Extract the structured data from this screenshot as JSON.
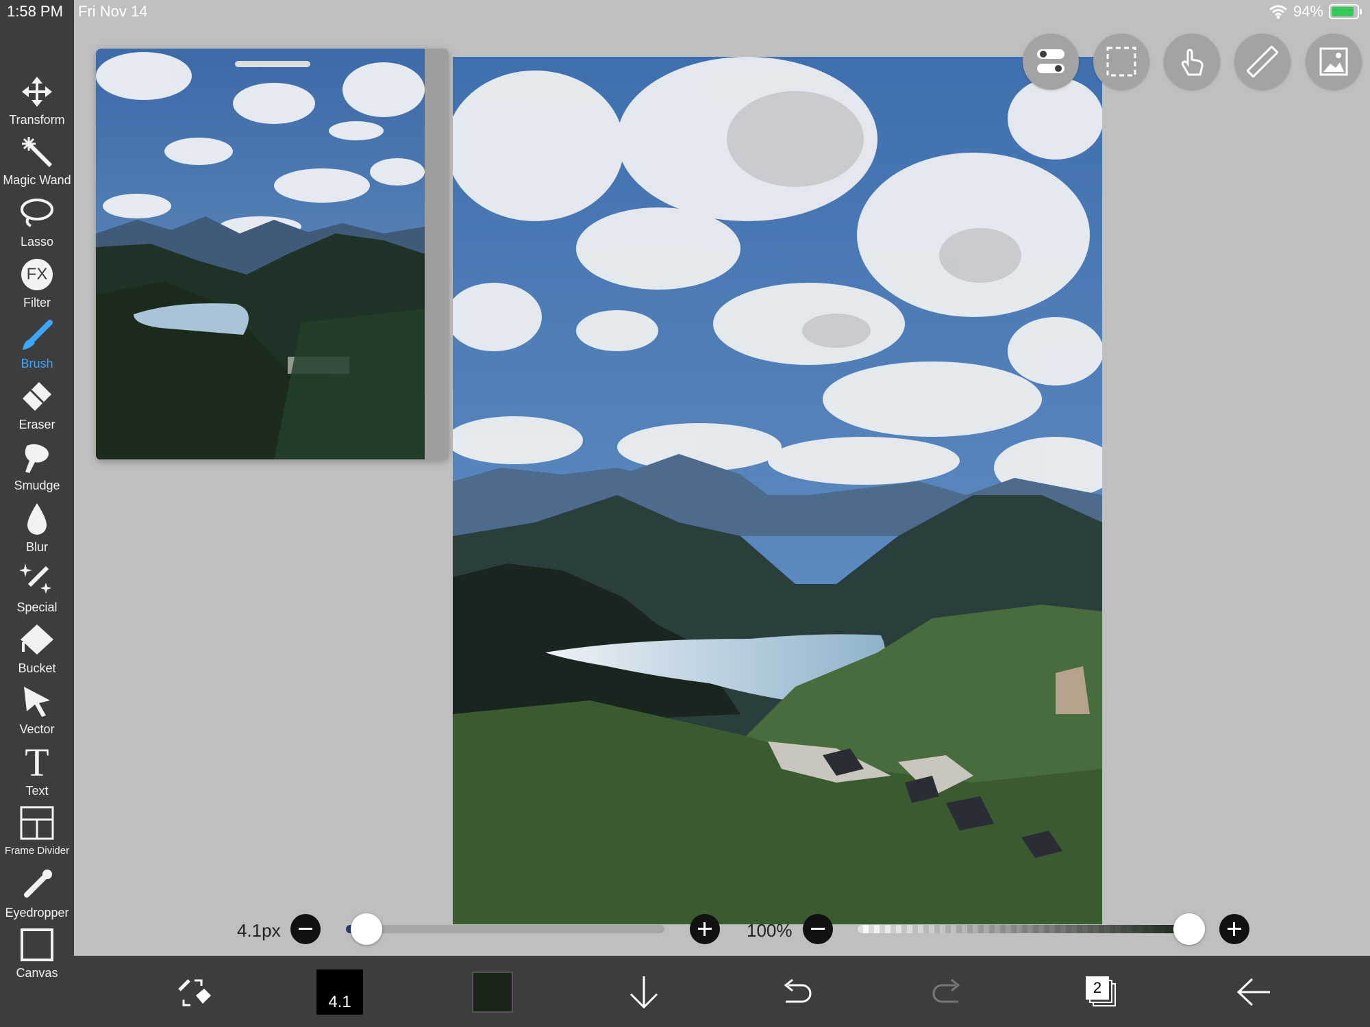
{
  "status": {
    "time": "1:58 PM",
    "date": "Fri Nov 14",
    "battery": "94%"
  },
  "tools": [
    {
      "label": "Transform",
      "icon": "move-arrows-icon"
    },
    {
      "label": "Magic Wand",
      "icon": "magic-wand-icon"
    },
    {
      "label": "Lasso",
      "icon": "lasso-icon"
    },
    {
      "label": "Filter",
      "icon": "fx-icon"
    },
    {
      "label": "Brush",
      "icon": "brush-icon",
      "active": true
    },
    {
      "label": "Eraser",
      "icon": "eraser-icon"
    },
    {
      "label": "Smudge",
      "icon": "smudge-finger-icon"
    },
    {
      "label": "Blur",
      "icon": "droplet-icon"
    },
    {
      "label": "Special",
      "icon": "sparkle-pen-icon"
    },
    {
      "label": "Bucket",
      "icon": "bucket-icon"
    },
    {
      "label": "Vector",
      "icon": "cursor-arrow-icon"
    },
    {
      "label": "Text",
      "icon": "text-t-icon"
    },
    {
      "label": "Frame Divider",
      "icon": "frame-divider-icon"
    },
    {
      "label": "Eyedropper",
      "icon": "eyedropper-icon"
    },
    {
      "label": "Canvas",
      "icon": "canvas-square-icon"
    }
  ],
  "fx_glyph": "FX",
  "text_glyph": "T",
  "topbar_buttons": [
    "toggle-switch-icon",
    "selection-marquee-icon",
    "touch-gesture-icon",
    "ruler-icon",
    "image-reference-icon"
  ],
  "brush_size": {
    "label": "4.1px",
    "value": 4.1
  },
  "opacity": {
    "label": "100%",
    "value": 1.0
  },
  "bottom": {
    "brush_preview_value": "4.1",
    "layer_count": "2",
    "current_color": "#1a2419"
  },
  "colors": {
    "accent": "#3da6ff",
    "toolbar_bg": "#3d3d3d",
    "workspace_bg": "#bfbfbf"
  }
}
